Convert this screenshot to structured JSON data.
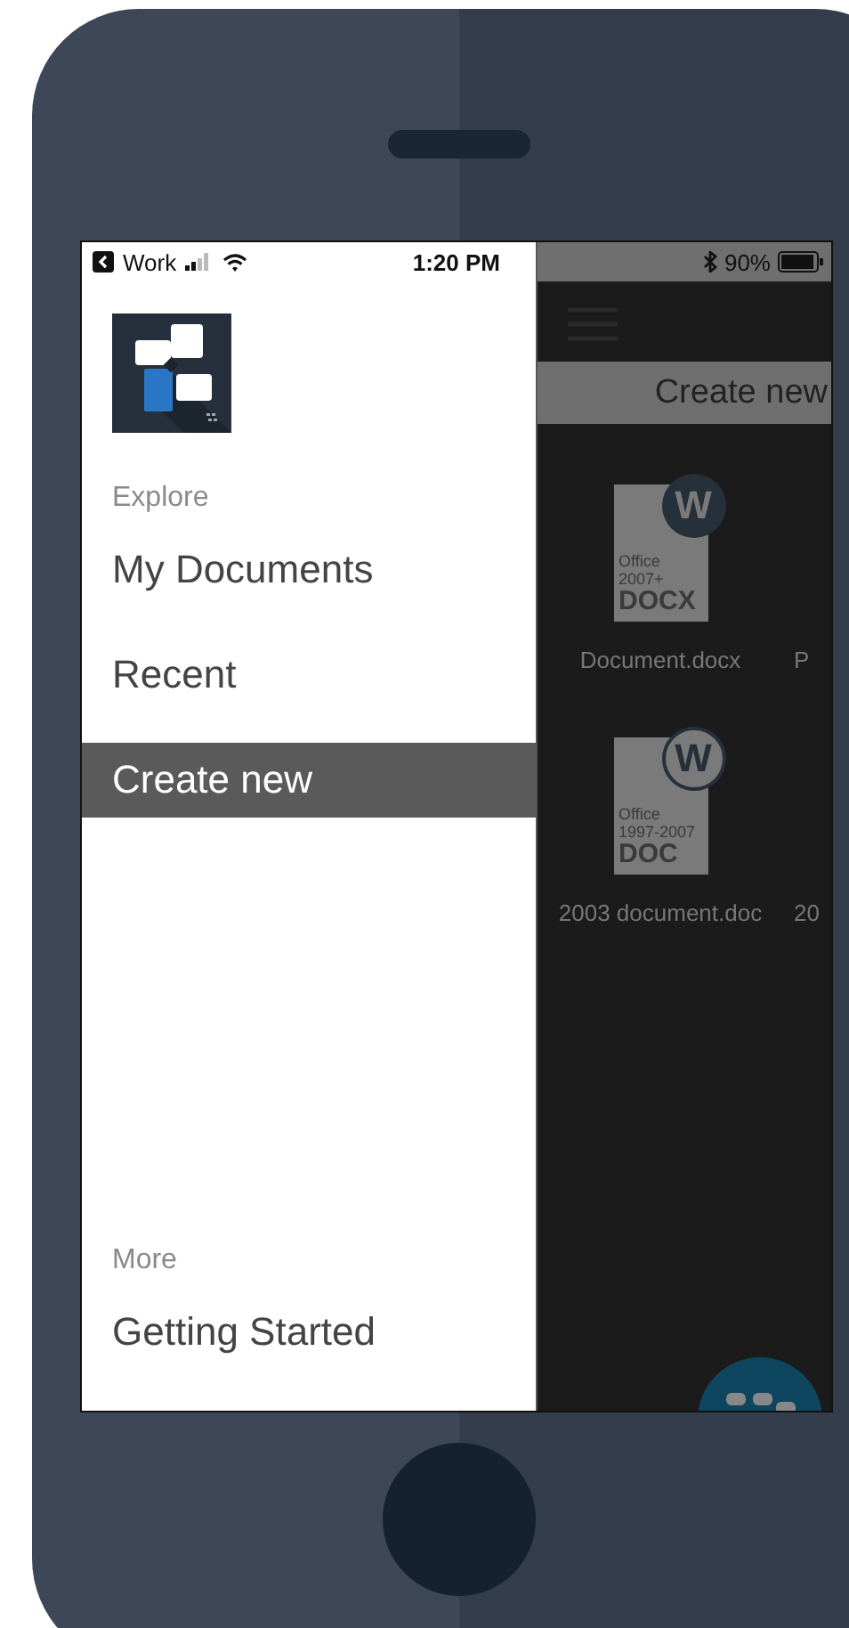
{
  "status_bar": {
    "carrier": "Work",
    "time": "1:20 PM",
    "battery": "90%"
  },
  "drawer": {
    "sections": [
      {
        "label": "Explore",
        "items": [
          {
            "label": "My Documents",
            "selected": false
          },
          {
            "label": "Recent",
            "selected": false
          },
          {
            "label": "Create new",
            "selected": true
          }
        ]
      },
      {
        "label": "More",
        "items": [
          {
            "label": "Getting Started",
            "selected": false
          }
        ]
      }
    ]
  },
  "content": {
    "header": "Create new",
    "rows": [
      {
        "file": {
          "name": "Document.docx",
          "badge": "W",
          "kind": "filled",
          "lines": [
            "Office",
            "2007+"
          ],
          "ext": "DOCX"
        },
        "next_name": "P"
      },
      {
        "file": {
          "name": "2003 document.doc",
          "badge": "W",
          "kind": "outline",
          "lines": [
            "Office",
            "1997-2007"
          ],
          "ext": "DOC"
        },
        "next_name": "20"
      }
    ]
  }
}
